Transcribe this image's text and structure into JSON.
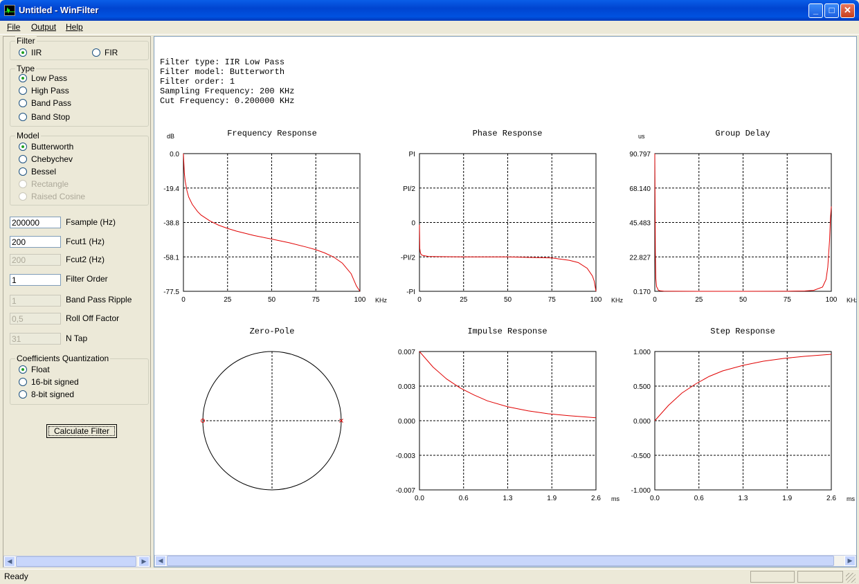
{
  "window": {
    "title": "Untitled - WinFilter"
  },
  "menu": [
    "File",
    "Output",
    "Help"
  ],
  "filter_group": {
    "title": "Filter",
    "options": [
      {
        "label": "IIR",
        "selected": true
      },
      {
        "label": "FIR",
        "selected": false
      }
    ]
  },
  "type_group": {
    "title": "Type",
    "options": [
      {
        "label": "Low Pass",
        "selected": true
      },
      {
        "label": "High Pass",
        "selected": false
      },
      {
        "label": "Band Pass",
        "selected": false
      },
      {
        "label": "Band Stop",
        "selected": false
      }
    ]
  },
  "model_group": {
    "title": "Model",
    "options": [
      {
        "label": "Butterworth",
        "selected": true
      },
      {
        "label": "Chebychev",
        "selected": false
      },
      {
        "label": "Bessel",
        "selected": false
      },
      {
        "label": "Rectangle",
        "selected": false,
        "disabled": true
      },
      {
        "label": "Raised Cosine",
        "selected": false,
        "disabled": true
      }
    ]
  },
  "params": [
    {
      "value": "200000",
      "label": "Fsample (Hz)",
      "enabled": true
    },
    {
      "value": "200",
      "label": "Fcut1 (Hz)",
      "enabled": true
    },
    {
      "value": "200",
      "label": "Fcut2 (Hz)",
      "enabled": false
    },
    {
      "value": "1",
      "label": "Filter Order",
      "enabled": true
    },
    {
      "value": "1",
      "label": "Band Pass Ripple",
      "enabled": false
    },
    {
      "value": "0,5",
      "label": "Roll Off Factor",
      "enabled": false
    },
    {
      "value": "31",
      "label": "N Tap",
      "enabled": false
    }
  ],
  "quant_group": {
    "title": "Coefficients Quantization",
    "options": [
      {
        "label": "Float",
        "selected": true
      },
      {
        "label": "16-bit signed",
        "selected": false
      },
      {
        "label": "8-bit signed",
        "selected": false
      }
    ]
  },
  "calculate_label": "Calculate Filter",
  "info_lines": [
    "Filter type: IIR Low Pass",
    "Filter model: Butterworth",
    "Filter order: 1",
    "Sampling Frequency: 200 KHz",
    "Cut Frequency: 0.200000 KHz"
  ],
  "status": "Ready",
  "chart_data": [
    {
      "type": "line",
      "title": "Frequency Response",
      "ylabel": "dB",
      "xlabel": "KHz",
      "xticks": [
        "0",
        "25",
        "50",
        "75",
        "100"
      ],
      "yticks": [
        "0.0",
        "-19.4",
        "-38.8",
        "-58.1",
        "-77.5"
      ],
      "xlim": [
        0,
        100
      ],
      "ylim": [
        -77.5,
        0
      ],
      "color": "#e00000",
      "x": [
        0,
        0.5,
        1,
        2,
        3,
        5,
        8,
        10,
        15,
        20,
        25,
        30,
        40,
        50,
        60,
        70,
        75,
        80,
        85,
        90,
        95,
        98,
        100
      ],
      "y": [
        0,
        -10.9,
        -15.3,
        -20.9,
        -24.4,
        -28.6,
        -32.6,
        -34.6,
        -37.9,
        -40.3,
        -42.1,
        -43.6,
        -46.1,
        -48.1,
        -50.2,
        -52.7,
        -54.1,
        -55.9,
        -58.2,
        -61.6,
        -67.6,
        -74.5,
        -77.5
      ]
    },
    {
      "type": "line",
      "title": "Phase Response",
      "xlabel": "KHz",
      "xticks": [
        "0",
        "25",
        "50",
        "75",
        "100"
      ],
      "yticks": [
        "PI",
        "PI/2",
        "0",
        "-PI/2",
        "-PI"
      ],
      "xlim": [
        0,
        100
      ],
      "ylim": [
        -3.1416,
        3.1416
      ],
      "color": "#e00000",
      "x": [
        0,
        0.2,
        0.5,
        1,
        2,
        5,
        10,
        25,
        50,
        75,
        85,
        90,
        95,
        98,
        99,
        100
      ],
      "y": [
        -0.1,
        -1.19,
        -1.38,
        -1.47,
        -1.51,
        -1.55,
        -1.56,
        -1.57,
        -1.5708,
        -1.62,
        -1.73,
        -1.83,
        -2.09,
        -2.44,
        -2.68,
        -3.14
      ]
    },
    {
      "type": "line",
      "title": "Group Delay",
      "ylabel": "us",
      "xlabel": "KHz",
      "xticks": [
        "0",
        "25",
        "50",
        "75",
        "100"
      ],
      "yticks": [
        "90.797",
        "68.140",
        "45.483",
        "22.827",
        "0.170"
      ],
      "xlim": [
        0,
        100
      ],
      "ylim": [
        0.17,
        90.797
      ],
      "color": "#e00000",
      "x": [
        0,
        0.3,
        0.6,
        1,
        2,
        3,
        5,
        10,
        25,
        50,
        75,
        85,
        90,
        95,
        97,
        98,
        99,
        99.5,
        100
      ],
      "y": [
        90.8,
        26.0,
        8.5,
        3.3,
        0.9,
        0.5,
        0.3,
        0.2,
        0.17,
        0.17,
        0.2,
        0.4,
        0.8,
        3.0,
        8.0,
        16.0,
        34.0,
        48.0,
        56.0
      ]
    },
    {
      "type": "scatter",
      "title": "Zero-Pole",
      "points": [
        {
          "kind": "zero",
          "re": -1,
          "im": 0
        },
        {
          "kind": "pole",
          "re": 1,
          "im": 0
        }
      ]
    },
    {
      "type": "line",
      "title": "Impulse Response",
      "xlabel": "ms",
      "xticks": [
        "0.0",
        "0.6",
        "1.3",
        "1.9",
        "2.6"
      ],
      "yticks": [
        "0.007",
        "0.003",
        "0.000",
        "-0.003",
        "-0.007"
      ],
      "xlim": [
        0,
        2.6
      ],
      "ylim": [
        -0.00697,
        0.00697
      ],
      "color": "#e00000",
      "x": [
        0,
        0.2,
        0.4,
        0.6,
        0.8,
        1.0,
        1.3,
        1.6,
        1.9,
        2.2,
        2.6
      ],
      "y": [
        0.00697,
        0.0054,
        0.0042,
        0.0033,
        0.0026,
        0.002,
        0.0014,
        0.001,
        0.0007,
        0.0005,
        0.0003
      ]
    },
    {
      "type": "line",
      "title": "Step Response",
      "xlabel": "ms",
      "xticks": [
        "0.0",
        "0.6",
        "1.3",
        "1.9",
        "2.6"
      ],
      "yticks": [
        "1.000",
        "0.500",
        "0.000",
        "-0.500",
        "-1.000"
      ],
      "xlim": [
        0,
        2.6
      ],
      "ylim": [
        -1,
        1
      ],
      "color": "#e00000",
      "x": [
        0,
        0.2,
        0.4,
        0.6,
        0.8,
        1.0,
        1.3,
        1.6,
        1.9,
        2.2,
        2.6
      ],
      "y": [
        0,
        0.22,
        0.4,
        0.53,
        0.64,
        0.72,
        0.8,
        0.86,
        0.9,
        0.93,
        0.96
      ]
    }
  ]
}
